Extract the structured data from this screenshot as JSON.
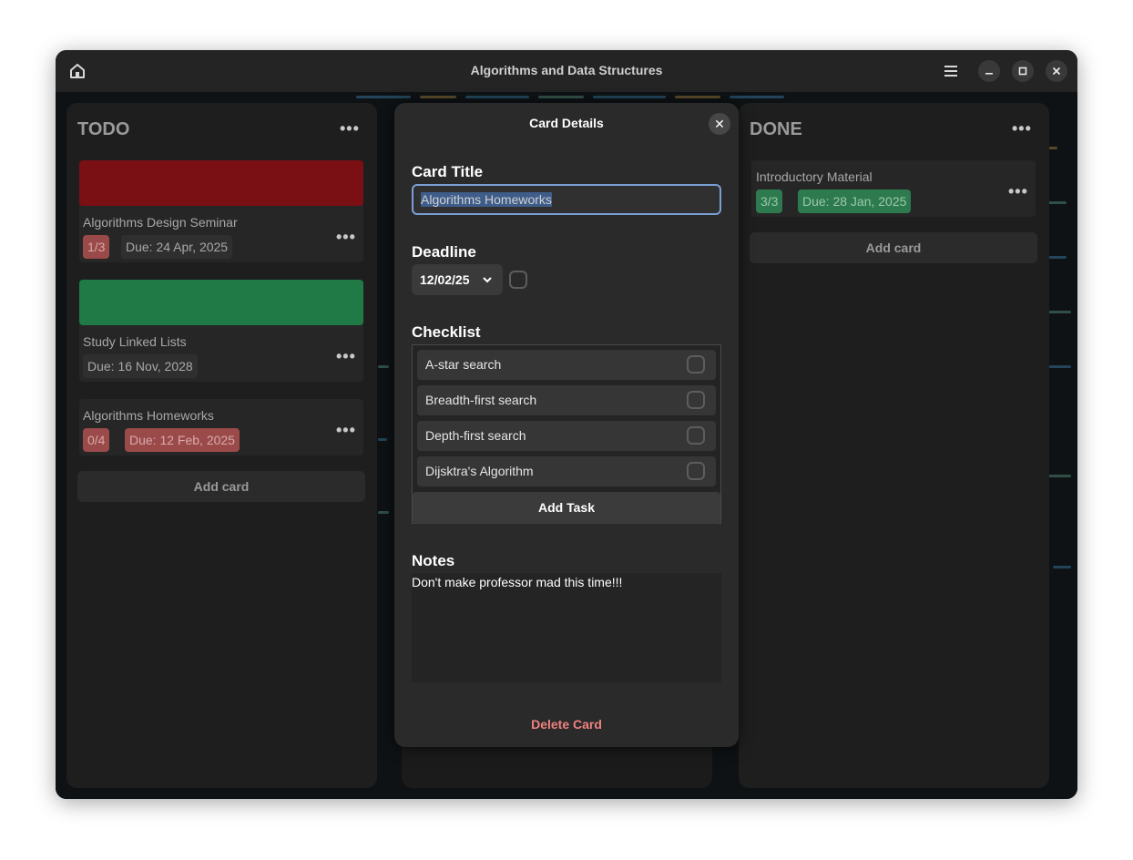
{
  "window": {
    "title": "Algorithms and Data Structures",
    "icons": {
      "home": "home-icon",
      "menu": "hamburger-menu-icon",
      "minimize": "minimize-icon",
      "maximize": "maximize-icon",
      "close": "close-icon"
    }
  },
  "columns": [
    {
      "title": "TODO",
      "menu_glyph": "•••",
      "cards": [
        {
          "cover_color": "#7a0f14",
          "title": "Algorithms Design Seminar",
          "progress": "1/3",
          "due": "Due: 24 Apr, 2025",
          "menu_glyph": "•••"
        },
        {
          "cover_color": "#1f7a46",
          "title": "Study Linked Lists",
          "due": "Due: 16 Nov, 2028",
          "menu_glyph": "•••"
        },
        {
          "title": "Algorithms Homeworks",
          "progress": "0/4",
          "due": "Due: 12 Feb, 2025",
          "menu_glyph": "•••"
        }
      ],
      "add_card": "Add card"
    },
    {
      "title": "DONE",
      "menu_glyph": "•••",
      "cards": [
        {
          "title": "Introductory Material",
          "progress": "3/3",
          "due": "Due: 28 Jan, 2025",
          "menu_glyph": "•••"
        }
      ],
      "add_card": "Add card"
    }
  ],
  "dialog": {
    "title": "Card Details",
    "close_glyph": "✕",
    "card_title_label": "Card Title",
    "card_title_value": "Algorithms Homeworks",
    "deadline_label": "Deadline",
    "deadline_value": "12/02/25",
    "chevron_glyph": "⌄",
    "checklist_label": "Checklist",
    "tasks": [
      {
        "label": "A-star search",
        "checked": false
      },
      {
        "label": "Breadth-first search",
        "checked": false
      },
      {
        "label": "Depth-first search",
        "checked": false
      },
      {
        "label": "Dijsktra's Algorithm",
        "checked": false
      }
    ],
    "add_task": "Add Task",
    "notes_label": "Notes",
    "notes_value": "Don't make professor mad this time!!!",
    "delete": "Delete Card"
  },
  "colors": {
    "accent_focus": "#7a9fd4",
    "danger": "#f08080",
    "badge_red": "#9b4a4a",
    "badge_green": "#2e7a4f"
  }
}
